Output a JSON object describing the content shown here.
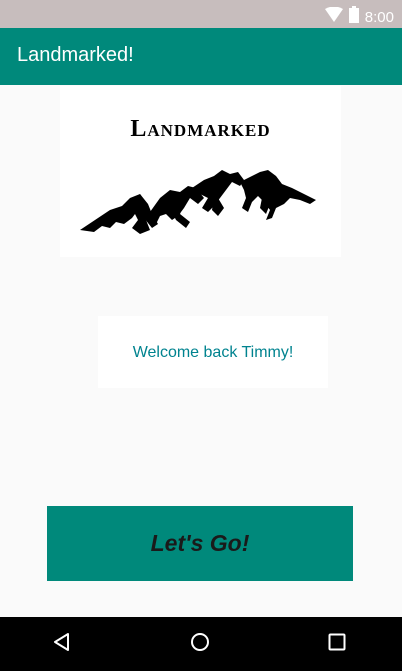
{
  "status_bar": {
    "time": "8:00",
    "icons": [
      "wifi-icon",
      "battery-icon"
    ]
  },
  "app_bar": {
    "title": "Landmarked!"
  },
  "logo": {
    "text": "Landmarked",
    "image": "mountains-icon"
  },
  "welcome": {
    "message": "Welcome back Timmy!"
  },
  "primary_action": {
    "label": "Let's Go!"
  },
  "nav_bar": {
    "buttons": [
      "back-icon",
      "home-icon",
      "recents-icon"
    ]
  },
  "colors": {
    "primary": "#00897b",
    "status_bar": "#c7bdbd",
    "welcome_text": "#00838f",
    "background": "#fafafa",
    "nav_bar": "#000000"
  }
}
